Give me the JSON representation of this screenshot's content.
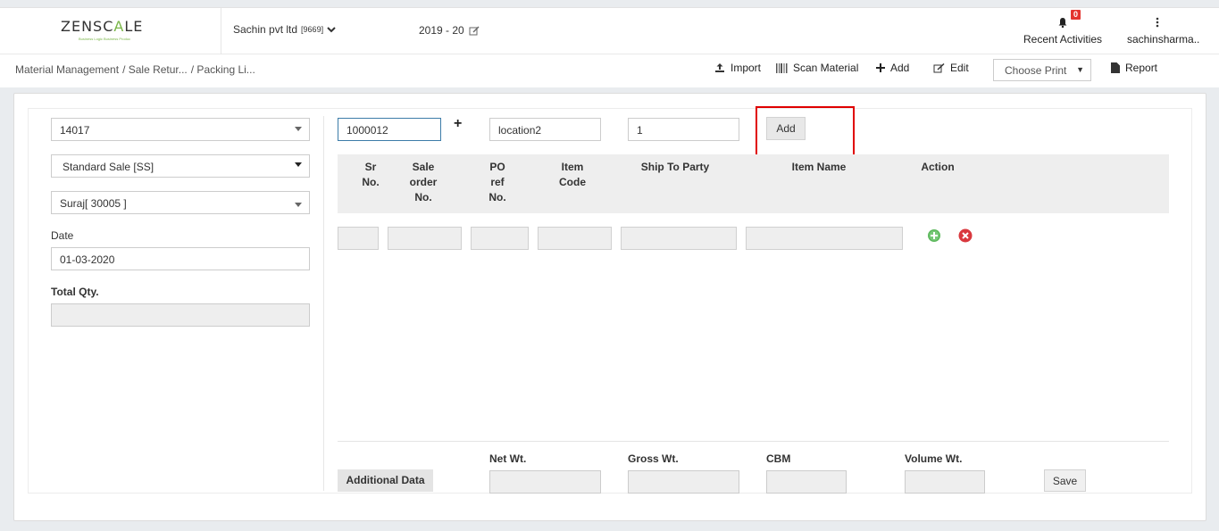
{
  "header": {
    "logo": {
      "text_main": "ZENSC",
      "text_accent_a": "A",
      "text_end": "LE",
      "tagline": "Business Logic Business Produc"
    },
    "company": {
      "name": "Sachin pvt ltd",
      "code": "[9669]"
    },
    "fiscal_year": "2019 - 20",
    "notifications": {
      "count": "0",
      "label": "Recent Activities"
    },
    "user": {
      "name": "sachinsharma.."
    }
  },
  "breadcrumb": {
    "items": [
      "Material Management",
      "/ Sale Retur...",
      "/ Packing Li..."
    ]
  },
  "toolbar": {
    "import_label": "Import",
    "scan_label": "Scan Material",
    "add_label": "Add",
    "edit_label": "Edit",
    "choose_print": "Choose Print",
    "report_label": "Report"
  },
  "form": {
    "party_code": "14017",
    "sale_type": "Standard Sale [SS]",
    "customer": "Suraj[ 30005 ]",
    "date_label": "Date",
    "date_value": "01-03-2020",
    "total_qty_label": "Total Qty.",
    "total_qty_value": ""
  },
  "scan_row": {
    "barcode_value": "1000012",
    "plus": "+",
    "location_value": "location2",
    "qty_value": "1",
    "add_button": "Add"
  },
  "table": {
    "columns": [
      {
        "label": "Sr No."
      },
      {
        "label": "Sale order No."
      },
      {
        "label": "PO ref No."
      },
      {
        "label": "Item Code"
      },
      {
        "label": "Ship To Party"
      },
      {
        "label": "Item Name"
      },
      {
        "label": "Action"
      }
    ]
  },
  "footer": {
    "additional_data": "Additional Data",
    "net_wt_label": "Net Wt.",
    "gross_wt_label": "Gross Wt.",
    "cbm_label": "CBM",
    "volume_wt_label": "Volume Wt.",
    "save_label": "Save"
  },
  "colors": {
    "accent_green": "#7ab648",
    "badge_red": "#e3342f",
    "highlight_red": "#e00000",
    "add_icon_green": "#5cb85c",
    "remove_icon_red": "#d9383e"
  }
}
